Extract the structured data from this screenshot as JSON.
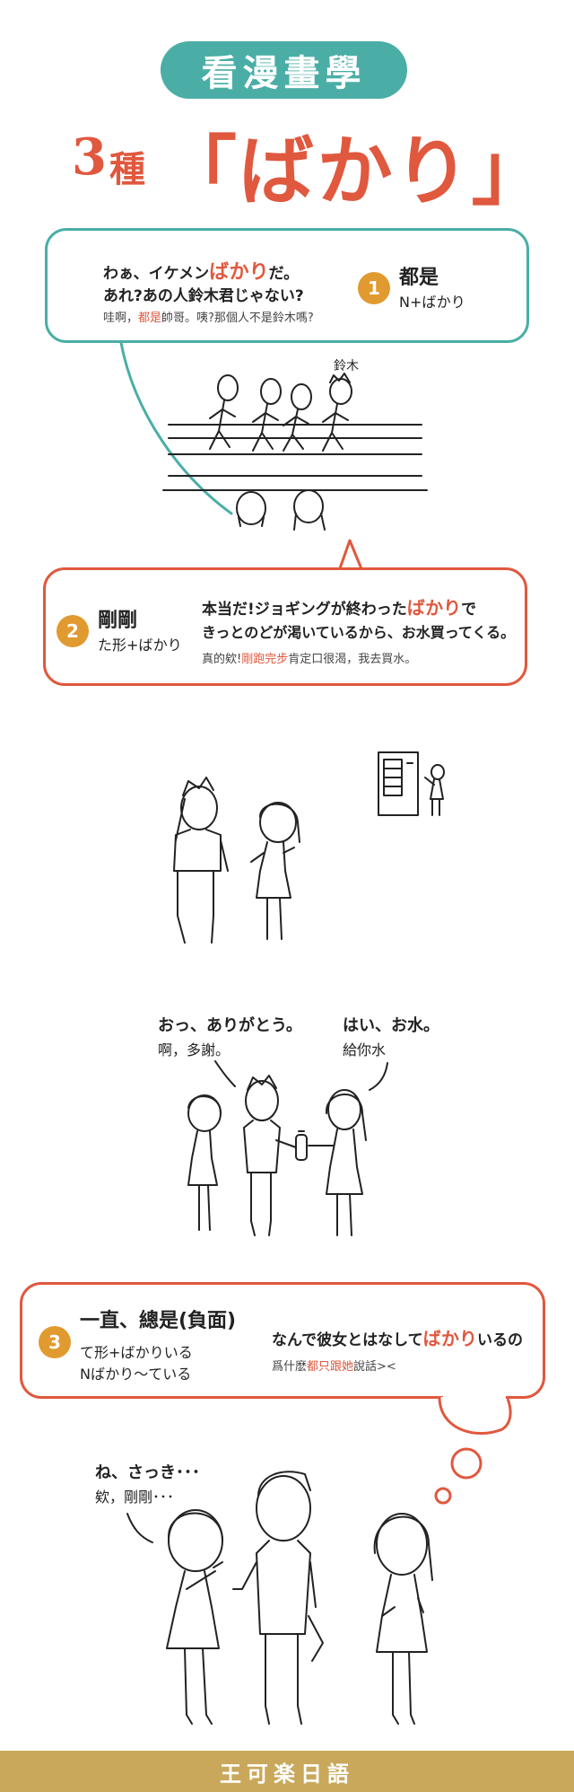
{
  "header": {
    "pill_title": "看漫畫學",
    "title_number": "3",
    "title_kind": "種",
    "title_main": "「ばかり」"
  },
  "section1": {
    "badge": "1",
    "meaning": "都是",
    "pattern": "N+ばかり",
    "jp_line1_pre": "わぁ、イケメン",
    "jp_line1_hl": "ばかり",
    "jp_line1_post": "だ。",
    "jp_line2": "あれ?あの人鈴木君じゃない?",
    "zh_pre": "哇啊，",
    "zh_hl": "都是",
    "zh_post": "帥哥。咦?那個人不是鈴木嗎?",
    "name_tag": "鈴木"
  },
  "section2": {
    "badge": "2",
    "meaning": "剛剛",
    "pattern": "た形+ばかり",
    "jp_line1_pre": "本当だ!ジョギングが終わった",
    "jp_line1_hl": "ばかり",
    "jp_line1_post": "で",
    "jp_line2": "きっとのどが渇いているから、お水買ってくる。",
    "zh_pre": "真的欸!",
    "zh_hl": "剛跑完步",
    "zh_post": "肯定口很渴，我去買水。"
  },
  "scene3": {
    "left_jp": "おっ、ありがとう。",
    "left_zh": "啊，多謝。",
    "right_jp": "はい、お水。",
    "right_zh": "給你水"
  },
  "section3": {
    "badge": "3",
    "meaning": "一直、總是(負面)",
    "pattern1": "て形+ばかりいる",
    "pattern2": "Nばかり～ている",
    "jp_pre": "なんで彼女とはなして",
    "jp_hl": "ばかり",
    "jp_post": "いるの",
    "zh_pre": "爲什麽",
    "zh_hl": "都只跟她",
    "zh_post": "說話><"
  },
  "scene4": {
    "jp": "ね、さっき･･･",
    "zh": "欸，剛剛･･･"
  },
  "footer": {
    "brand": "王可楽日語"
  },
  "colors": {
    "teal": "#4aaea6",
    "red": "#e0583e",
    "orange": "#e19a2f",
    "gold": "#c9a85b"
  }
}
